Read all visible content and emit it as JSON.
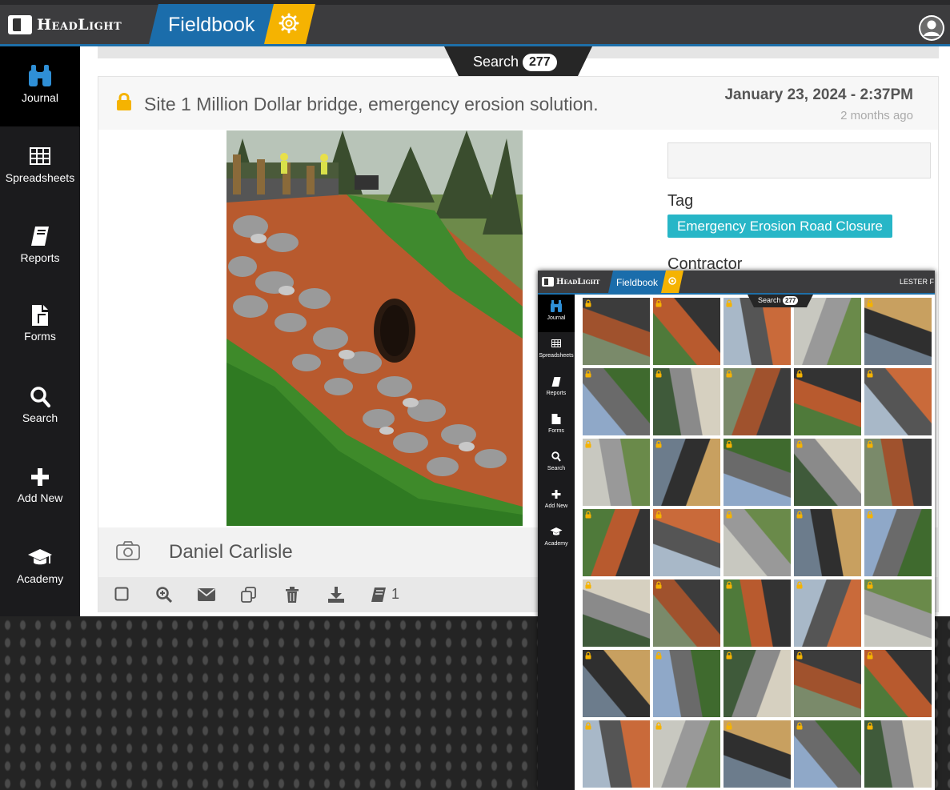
{
  "header": {
    "logo_text": "HeadLight",
    "app_name": "Fieldbook"
  },
  "sidebar": {
    "items": [
      {
        "label": "Journal",
        "icon": "binoculars-icon",
        "active": true
      },
      {
        "label": "Spreadsheets",
        "icon": "grid-icon",
        "active": false
      },
      {
        "label": "Reports",
        "icon": "book-icon",
        "active": false
      },
      {
        "label": "Forms",
        "icon": "forms-icon",
        "active": false
      },
      {
        "label": "Search",
        "icon": "search-icon",
        "active": false
      },
      {
        "label": "Add New",
        "icon": "plus-icon",
        "active": false
      },
      {
        "label": "Academy",
        "icon": "graduation-cap-icon",
        "active": false
      }
    ]
  },
  "search_tab": {
    "label": "Search",
    "count": "277"
  },
  "entry": {
    "title": "Site 1 Million Dollar bridge, emergency erosion solution.",
    "date": "January 23, 2024 - 2:37PM",
    "relative_time": "2 months ago",
    "tag_label": "Tag",
    "tag": "Emergency Erosion Road Closure",
    "contractor_label": "Contractor",
    "author": "Daniel Carlisle",
    "report_count": "1"
  },
  "actions": [
    {
      "name": "checkbox-icon"
    },
    {
      "name": "zoom-in-icon"
    },
    {
      "name": "email-icon"
    },
    {
      "name": "copy-icon"
    },
    {
      "name": "trash-icon"
    },
    {
      "name": "download-icon"
    },
    {
      "name": "report-book-icon"
    }
  ],
  "inset": {
    "logo_text": "HeadLight",
    "app_name": "Fieldbook",
    "user_text": "LESTER F",
    "search_label": "Search",
    "search_count": "277",
    "sidebar": [
      {
        "label": "Journal",
        "icon": "binoculars-icon"
      },
      {
        "label": "Spreadsheets",
        "icon": "grid-icon"
      },
      {
        "label": "Reports",
        "icon": "book-icon"
      },
      {
        "label": "Forms",
        "icon": "forms-icon"
      },
      {
        "label": "Search",
        "icon": "search-icon"
      },
      {
        "label": "Add New",
        "icon": "plus-icon"
      },
      {
        "label": "Academy",
        "icon": "graduation-cap-icon"
      }
    ]
  },
  "colors": {
    "brand_blue": "#1b6dab",
    "accent_yellow": "#f5b301",
    "tag_teal": "#27b6c7",
    "sidebar_bg": "#1b1b1d"
  }
}
